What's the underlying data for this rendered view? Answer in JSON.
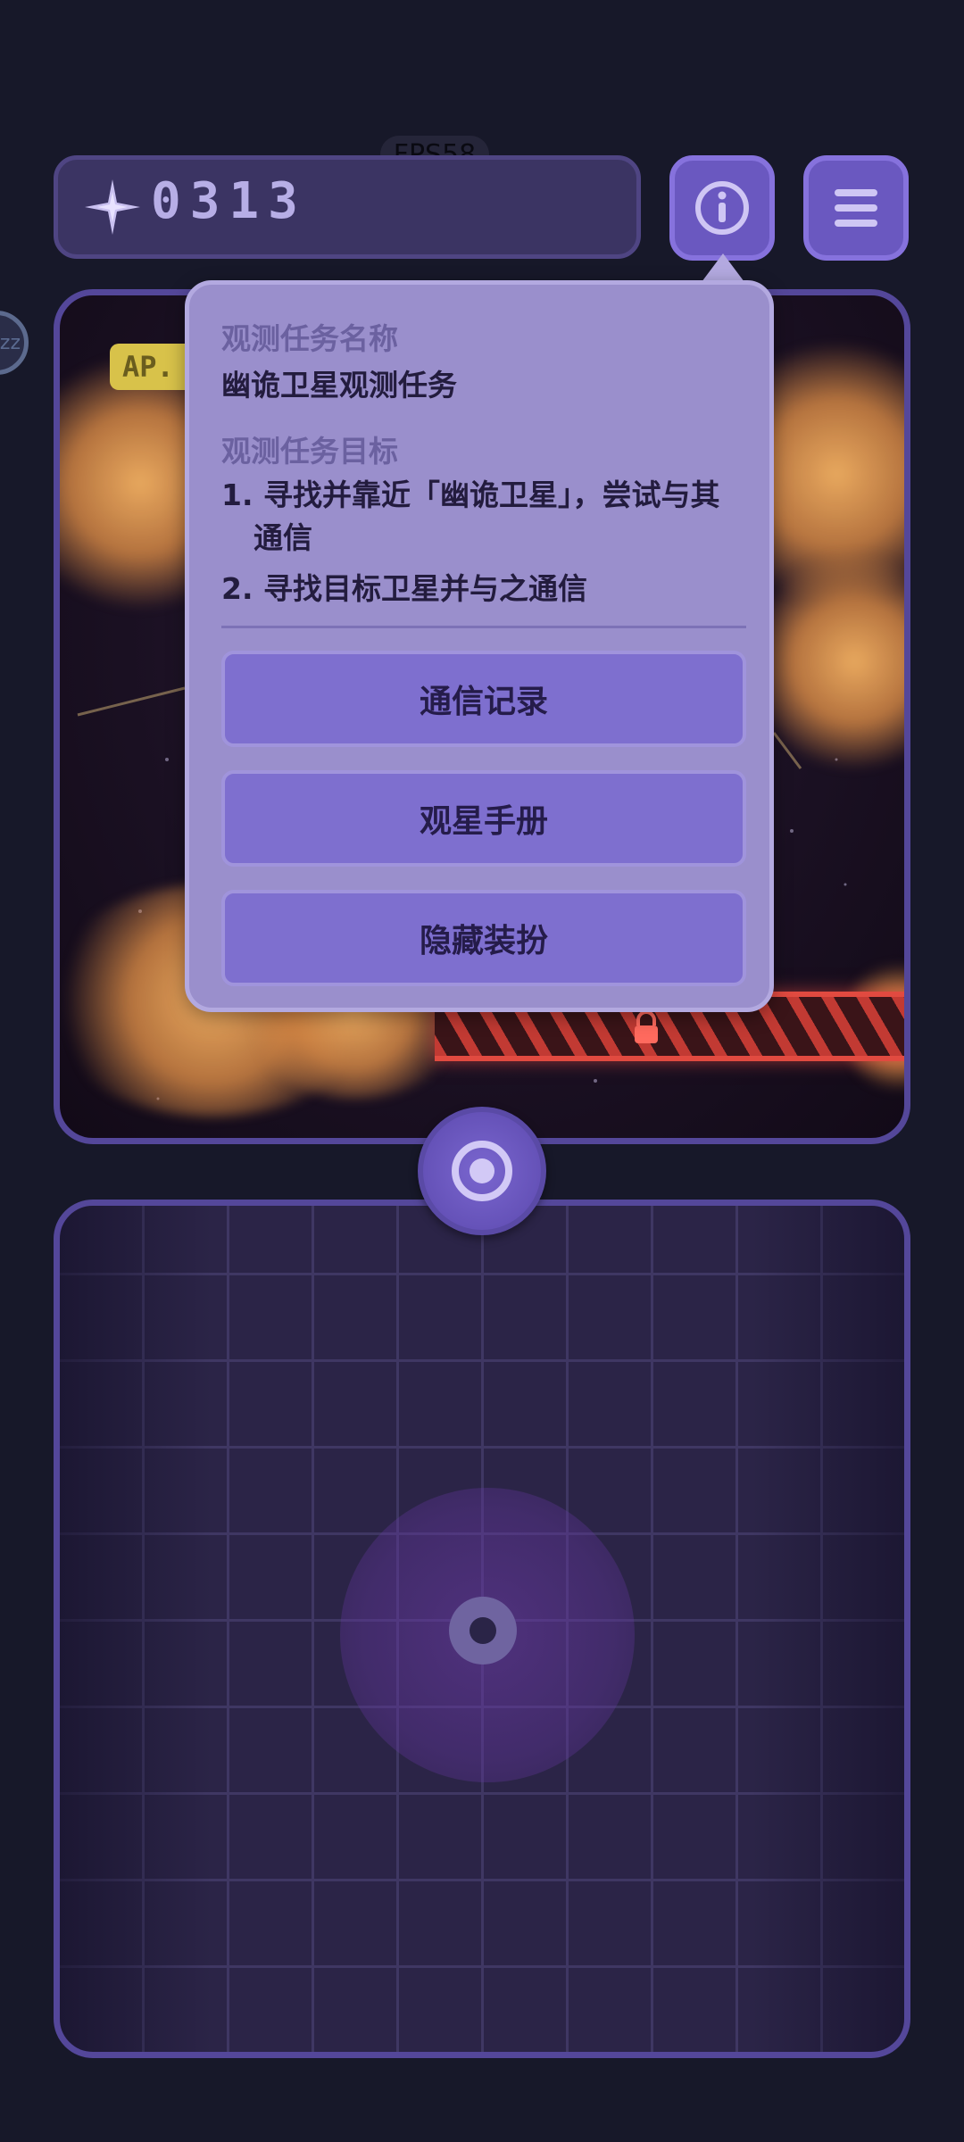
{
  "status": {
    "fps": "FPS58"
  },
  "header": {
    "score": "0313",
    "icons": {
      "star": "compass-star-icon",
      "info": "info-icon",
      "menu": "menu-icon"
    }
  },
  "viewport": {
    "ap_label": "AP.",
    "sleep_badge": "zz",
    "icons": {
      "lock": "lock-icon"
    }
  },
  "mission_popup": {
    "name_label": "观测任务名称",
    "name_value": "幽诡卫星观测任务",
    "goal_label": "观测任务目标",
    "goals": [
      "1. 寻找并靠近「幽诡卫星」，尝试与其通信",
      "2. 寻找目标卫星并与之通信"
    ],
    "buttons": {
      "comm_log": "通信记录",
      "star_guide": "观星手册",
      "hide_outfit": "隐藏装扮"
    }
  },
  "controls": {
    "target_icon": "target-icon",
    "joystick": "joystick"
  },
  "colors": {
    "background": "#171829",
    "accent": "#6a58c0",
    "popup": "#9a8fcc",
    "bridge": "#e14a40",
    "cloud": "#f4b162"
  }
}
